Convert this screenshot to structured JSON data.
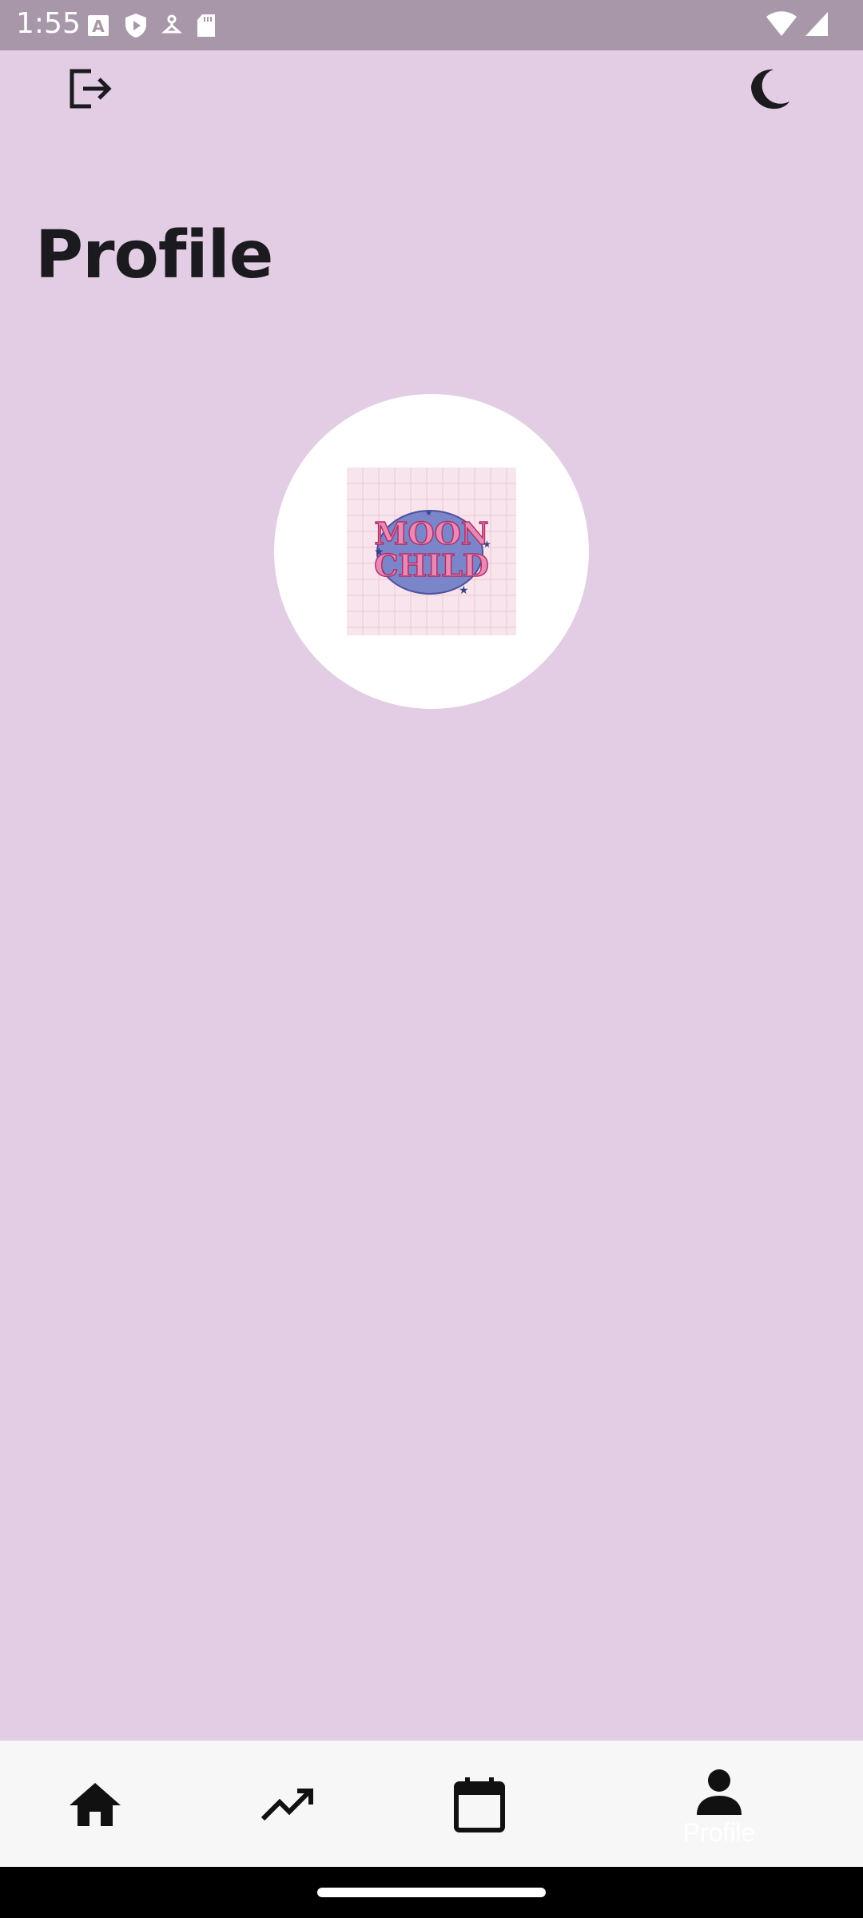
{
  "status_bar": {
    "time": "1:55",
    "left_icons": [
      "text-recognition-icon",
      "shield-play-icon",
      "hanger-icon",
      "sd-card-icon"
    ],
    "right_icons": [
      "wifi-icon",
      "signal-icon"
    ]
  },
  "top_bar": {
    "left_icon": "logout-icon",
    "right_icon": "dark-mode-moon-icon"
  },
  "page": {
    "title": "Profile"
  },
  "avatar": {
    "image": "moon-child-profile-image",
    "image_text": "MOON CHILD"
  },
  "bottom_nav": {
    "items": [
      {
        "icon": "home-icon",
        "label": ""
      },
      {
        "icon": "trending-up-icon",
        "label": ""
      },
      {
        "icon": "calendar-icon",
        "label": ""
      },
      {
        "icon": "person-icon",
        "label": "Profile",
        "active": true
      }
    ]
  },
  "colors": {
    "background": "#e2cde4",
    "status_bar": "#a896a9",
    "nav_background": "#f7f7f7",
    "title": "#1b1a1e"
  }
}
